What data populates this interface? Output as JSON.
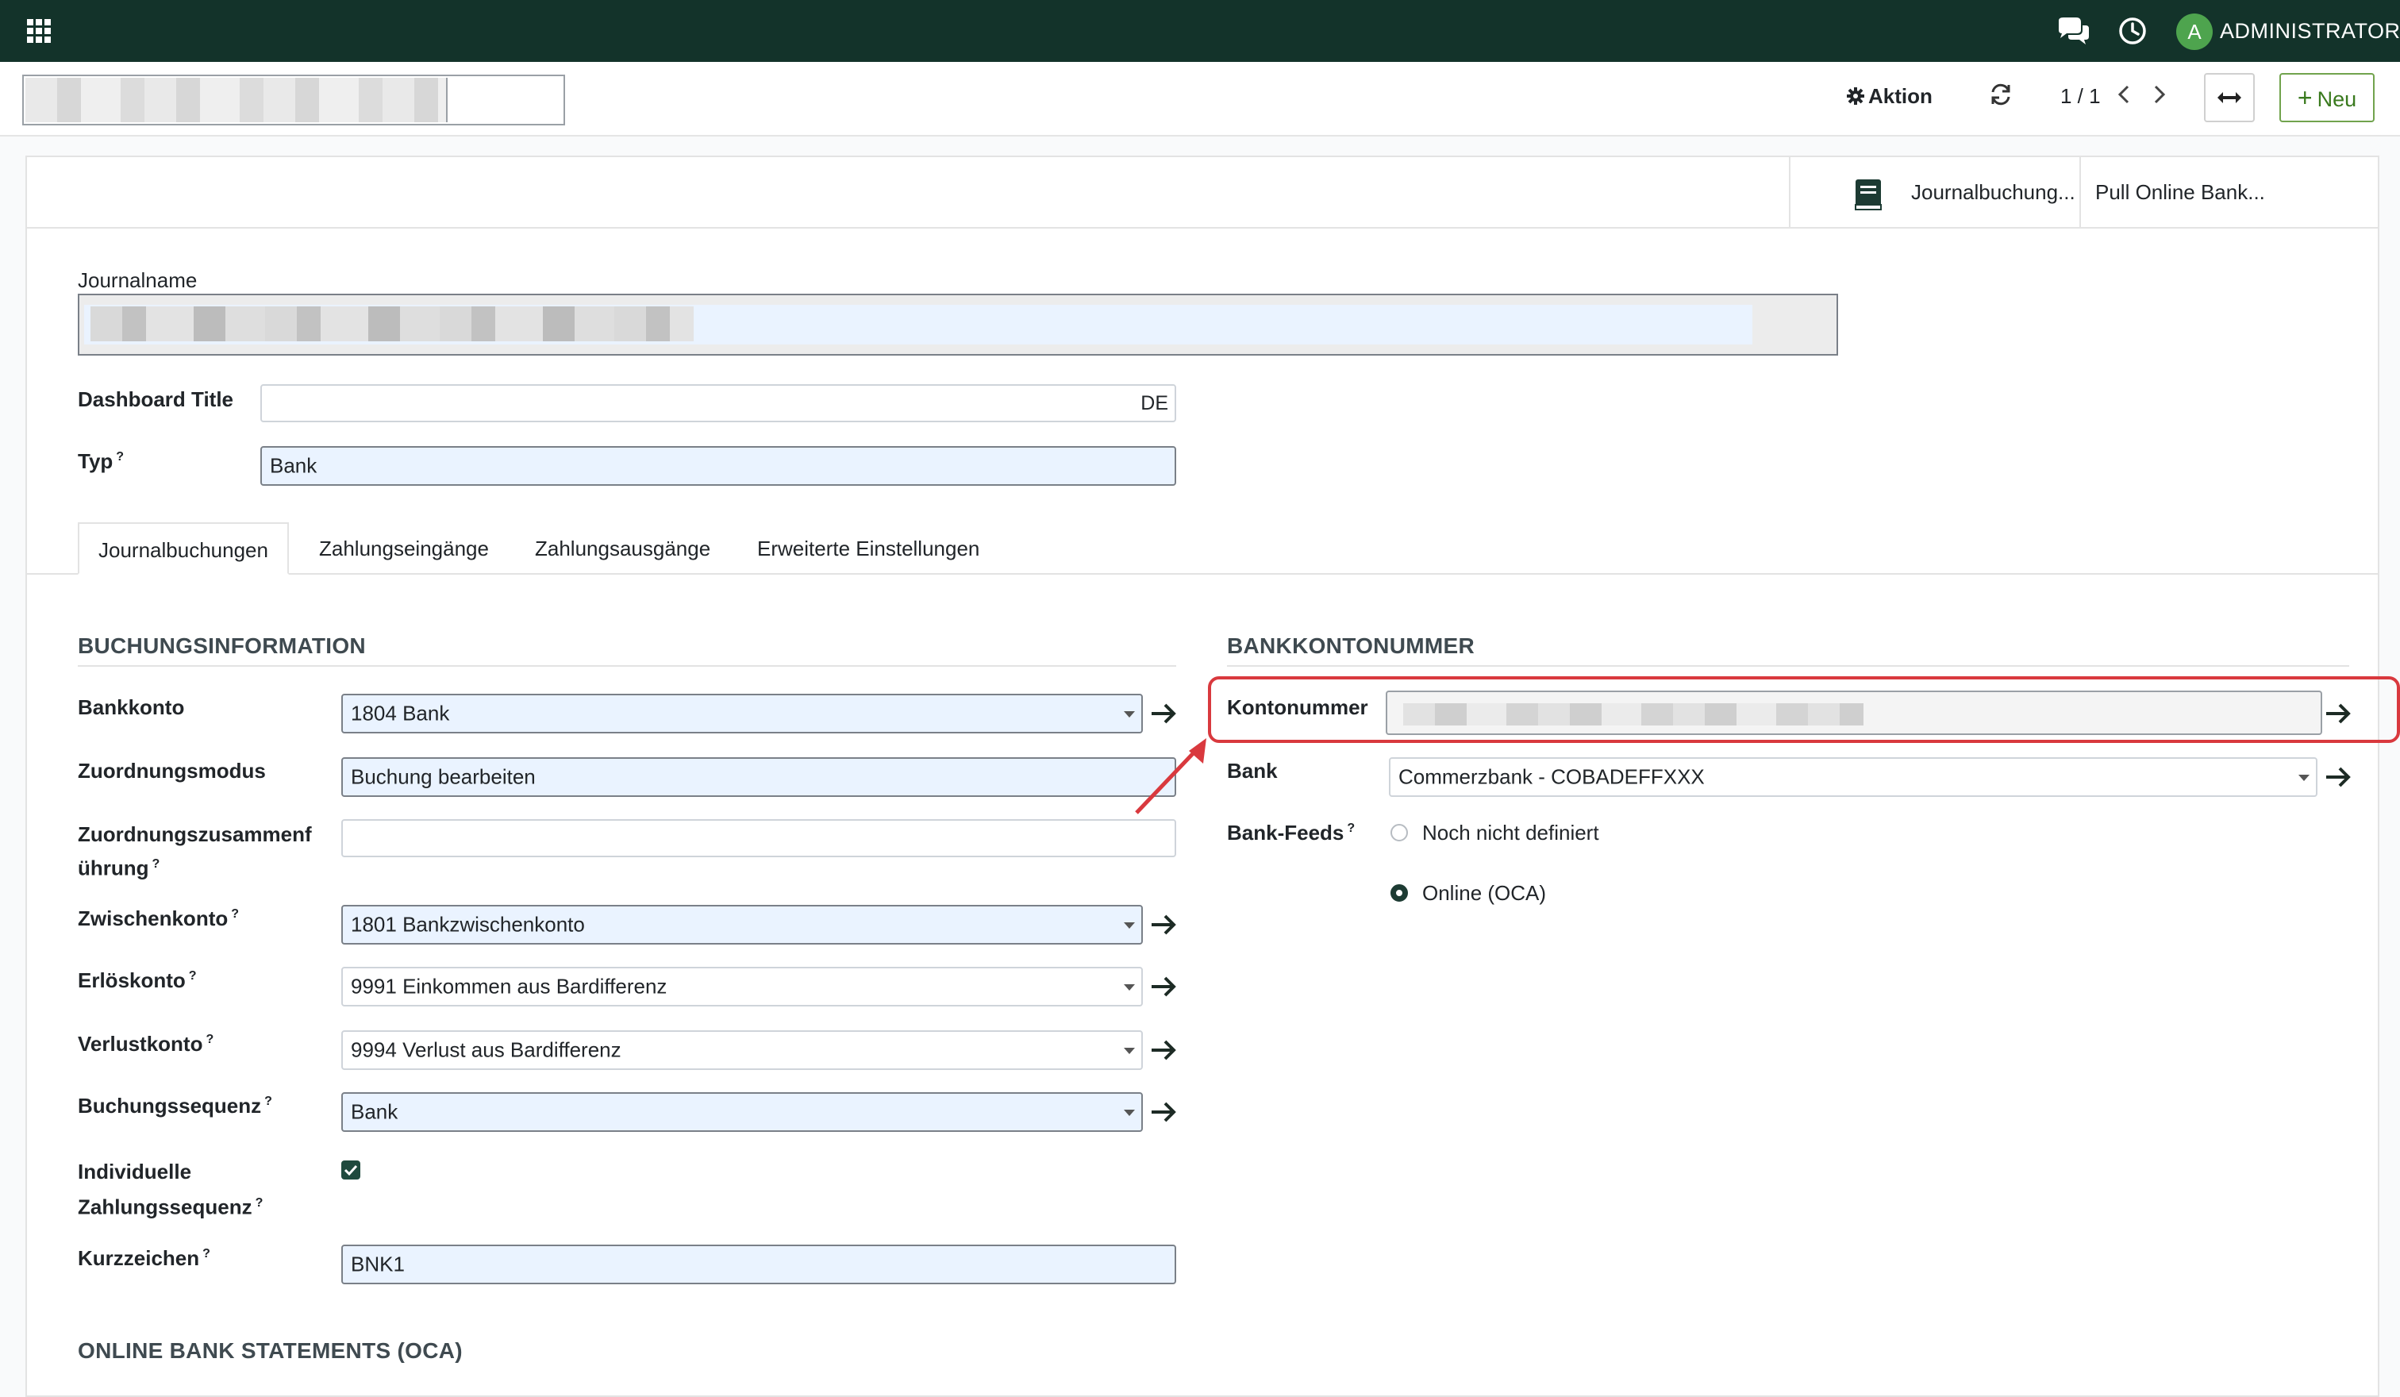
{
  "topbar": {
    "apps_icon": "grid-icon",
    "chat_icon": "chat-bubbles-icon",
    "clock_icon": "clock-icon",
    "avatar_letter": "A",
    "user_name": "ADMINISTRATOR",
    "avatar_color": "#4ea44e",
    "bar_color": "#13332a"
  },
  "control": {
    "action_label": "Aktion",
    "pager": "1 / 1",
    "new_label": "Neu"
  },
  "smart_buttons": {
    "journal_entries": "Journalbuchung...",
    "pull_online": "Pull Online Bank..."
  },
  "header_fields": {
    "journal_name_label": "Journalname",
    "dashboard_title_label": "Dashboard Title",
    "dashboard_lang": "DE",
    "type_label": "Typ",
    "type_value": "Bank"
  },
  "tabs": [
    {
      "label": "Journalbuchungen",
      "active": true
    },
    {
      "label": "Zahlungseingänge",
      "active": false
    },
    {
      "label": "Zahlungsausgänge",
      "active": false
    },
    {
      "label": "Erweiterte Einstellungen",
      "active": false
    }
  ],
  "left_section": {
    "title": "BUCHUNGSINFORMATION",
    "fields": {
      "bank_account_label": "Bankkonto",
      "bank_account_value": "1804 Bank",
      "matching_mode_label": "Zuordnungsmodus",
      "matching_mode_value": "Buchung bearbeiten",
      "matching_merge_label_1": "Zuordnungszusammenf",
      "matching_merge_label_2": "ührung",
      "suspense_label": "Zwischenkonto",
      "suspense_value": "1801 Bankzwischenkonto",
      "profit_label": "Erlöskonto",
      "profit_value": "9991 Einkommen aus Bardifferenz",
      "loss_label": "Verlustkonto",
      "loss_value": "9994 Verlust aus Bardifferenz",
      "sequence_label": "Buchungssequenz",
      "sequence_value": "Bank",
      "payment_seq_label_1": "Individuelle",
      "payment_seq_label_2": "Zahlungssequenz",
      "payment_seq_checked": true,
      "code_label": "Kurzzeichen",
      "code_value": "BNK1"
    }
  },
  "right_section": {
    "title": "BANKKONTONUMMER",
    "account_number_label": "Kontonummer",
    "bank_label": "Bank",
    "bank_value": "Commerzbank - COBADEFFXXX",
    "feeds_label": "Bank-Feeds",
    "feeds_options": [
      {
        "label": "Noch nicht definiert",
        "selected": false
      },
      {
        "label": "Online (OCA)",
        "selected": true
      }
    ]
  },
  "bottom_section": {
    "title": "ONLINE BANK STATEMENTS (OCA)"
  },
  "annotation": {
    "color": "#d9393e"
  }
}
